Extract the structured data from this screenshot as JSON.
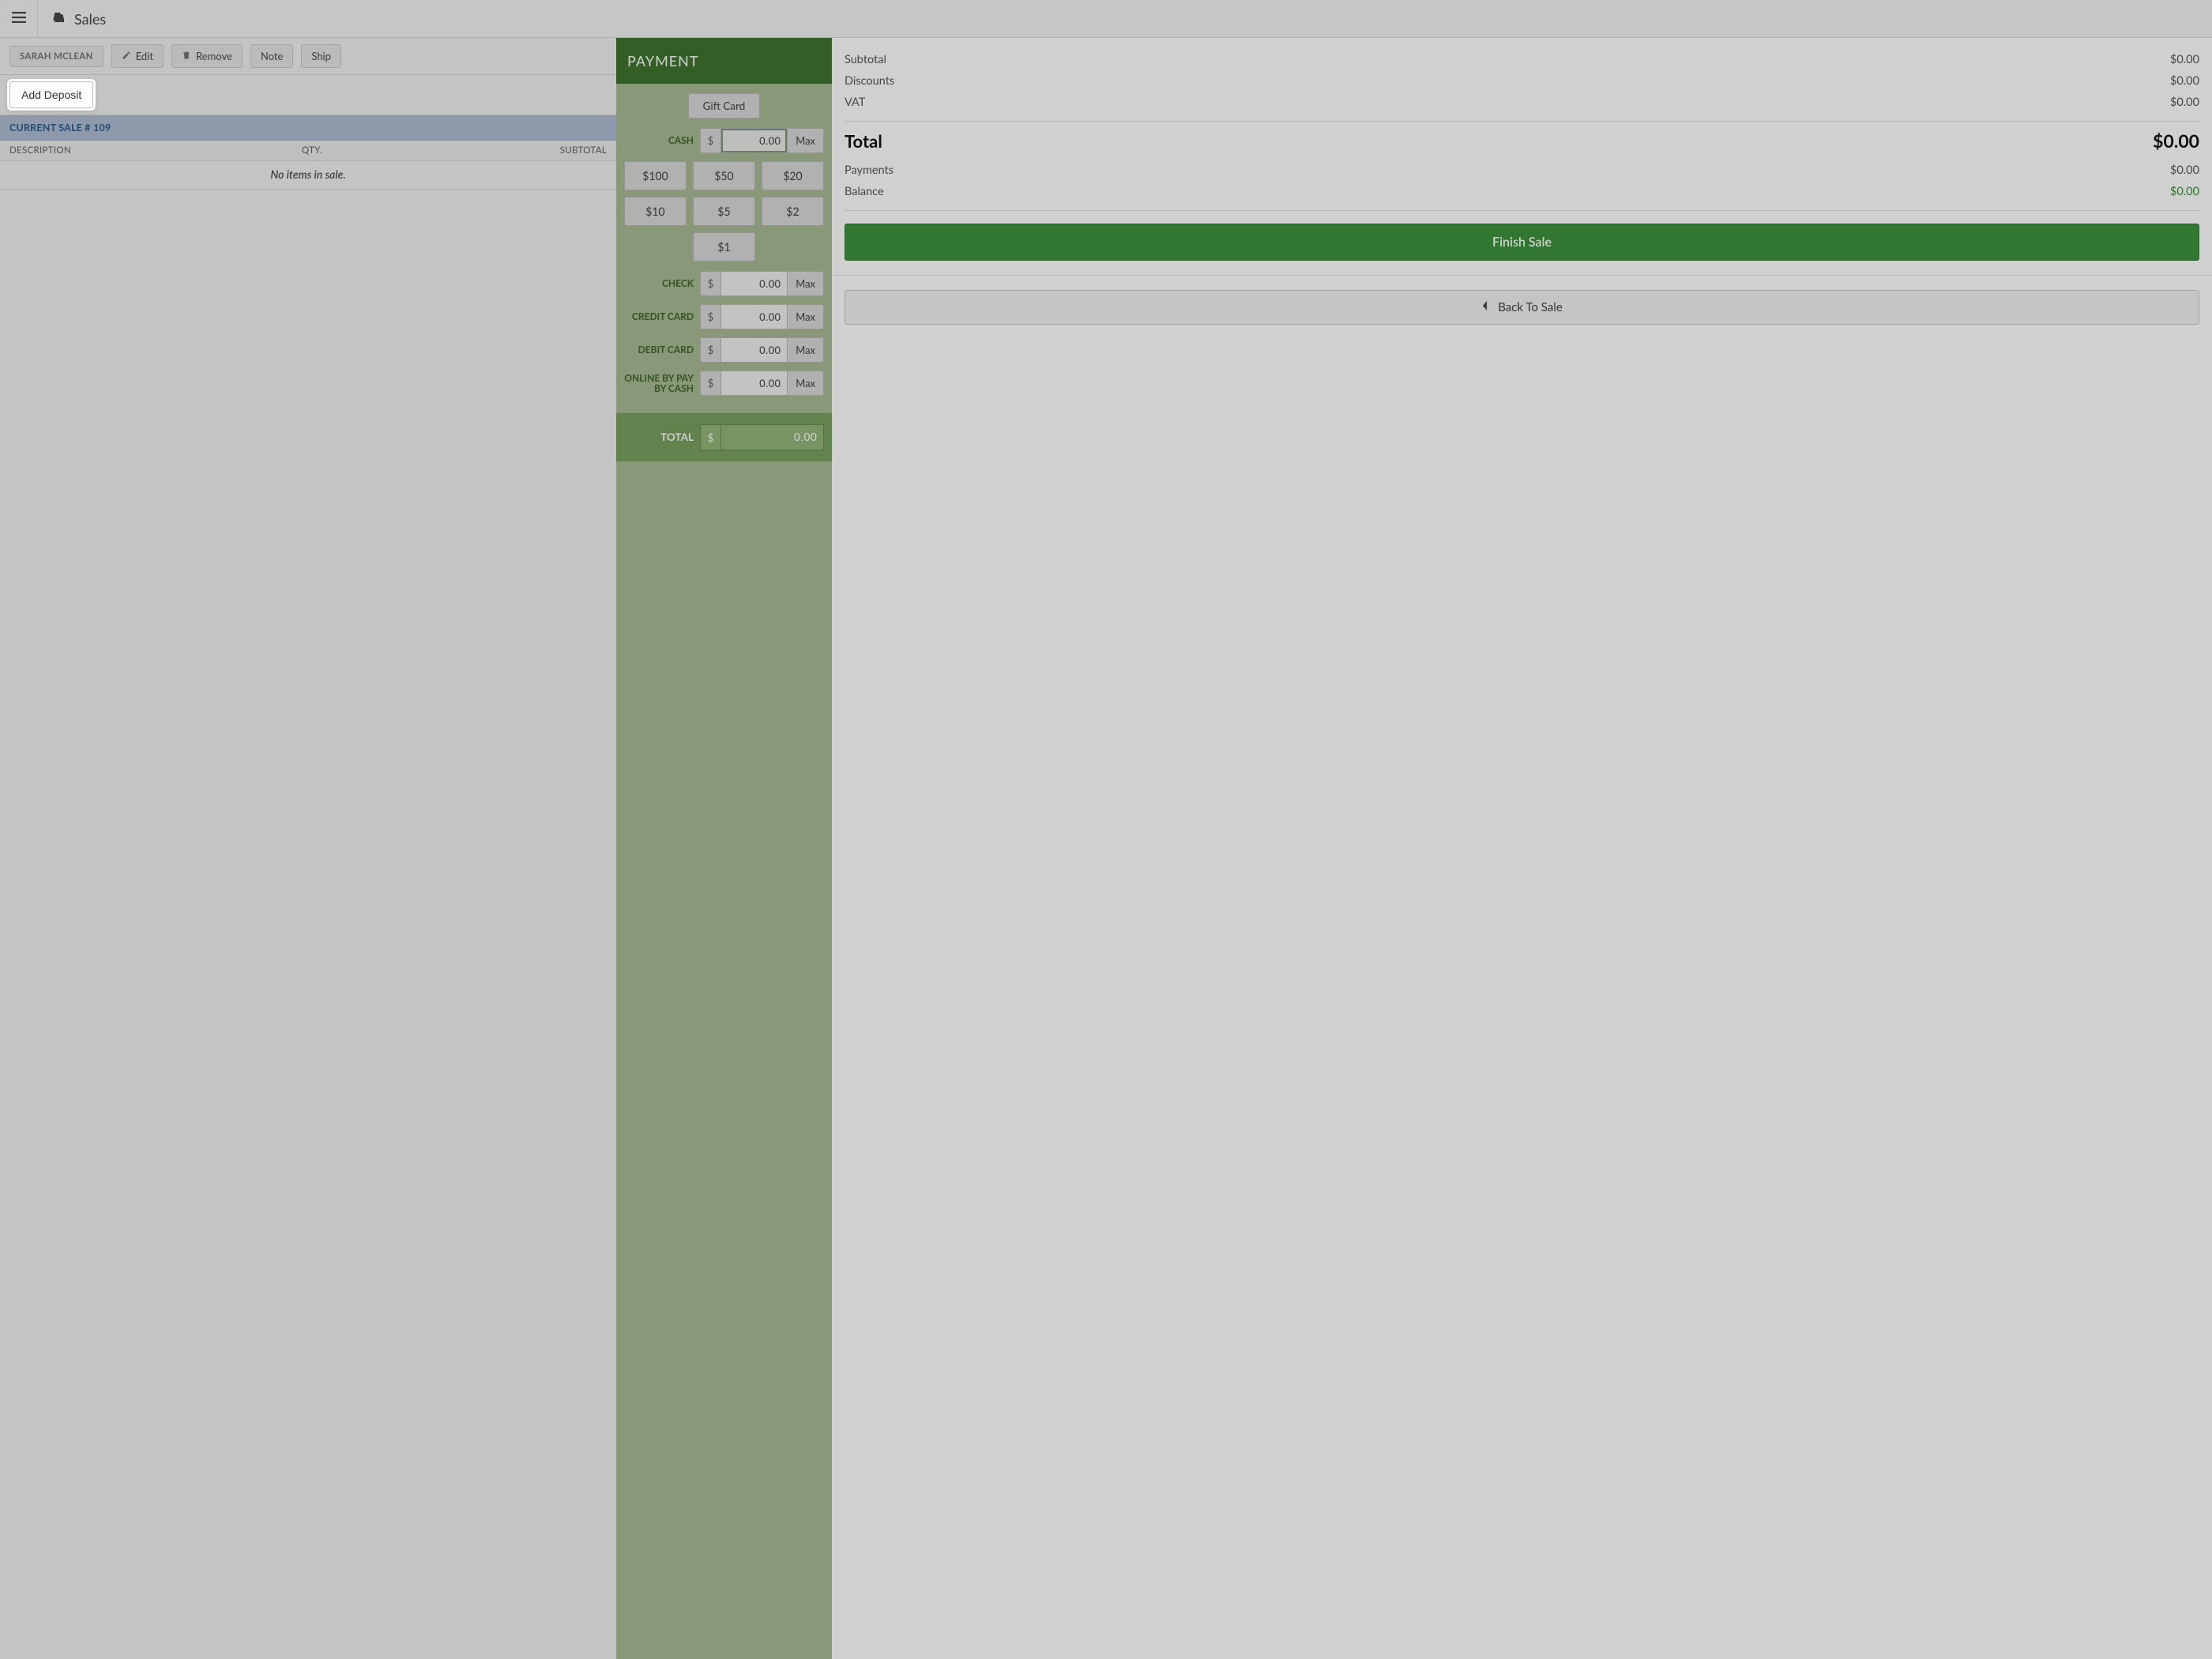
{
  "header": {
    "module": "Sales"
  },
  "toolbar": {
    "customer": "SARAH MCLEAN",
    "edit": "Edit",
    "remove": "Remove",
    "note": "Note",
    "ship": "Ship"
  },
  "deposit": {
    "add_label": "Add Deposit"
  },
  "sale": {
    "banner": "CURRENT SALE # 109",
    "columns": {
      "desc": "DESCRIPTION",
      "qty": "QTY.",
      "subtotal": "SUBTOTAL"
    },
    "empty": "No items in sale."
  },
  "payment": {
    "title": "PAYMENT",
    "gift_card": "Gift Card",
    "currency": "$",
    "max": "Max",
    "methods": {
      "cash": {
        "label": "CASH",
        "value": "0.00"
      },
      "check": {
        "label": "CHECK",
        "value": "0.00"
      },
      "credit": {
        "label": "CREDIT CARD",
        "value": "0.00"
      },
      "debit": {
        "label": "DEBIT CARD",
        "value": "0.00"
      },
      "online": {
        "label": "ONLINE BY PAY BY CASH",
        "value": "0.00"
      }
    },
    "quick": [
      "$100",
      "$50",
      "$20",
      "$10",
      "$5",
      "$2",
      "$1"
    ],
    "total_label": "TOTAL",
    "total_value": "0.00"
  },
  "summary": {
    "rows": {
      "subtotal": {
        "label": "Subtotal",
        "value": "$0.00"
      },
      "discounts": {
        "label": "Discounts",
        "value": "$0.00"
      },
      "vat": {
        "label": "VAT",
        "value": "$0.00"
      },
      "payments": {
        "label": "Payments",
        "value": "$0.00"
      },
      "balance": {
        "label": "Balance",
        "value": "$0.00"
      }
    },
    "total": {
      "label": "Total",
      "value": "$0.00"
    },
    "finish": "Finish Sale",
    "back": "Back To Sale"
  }
}
